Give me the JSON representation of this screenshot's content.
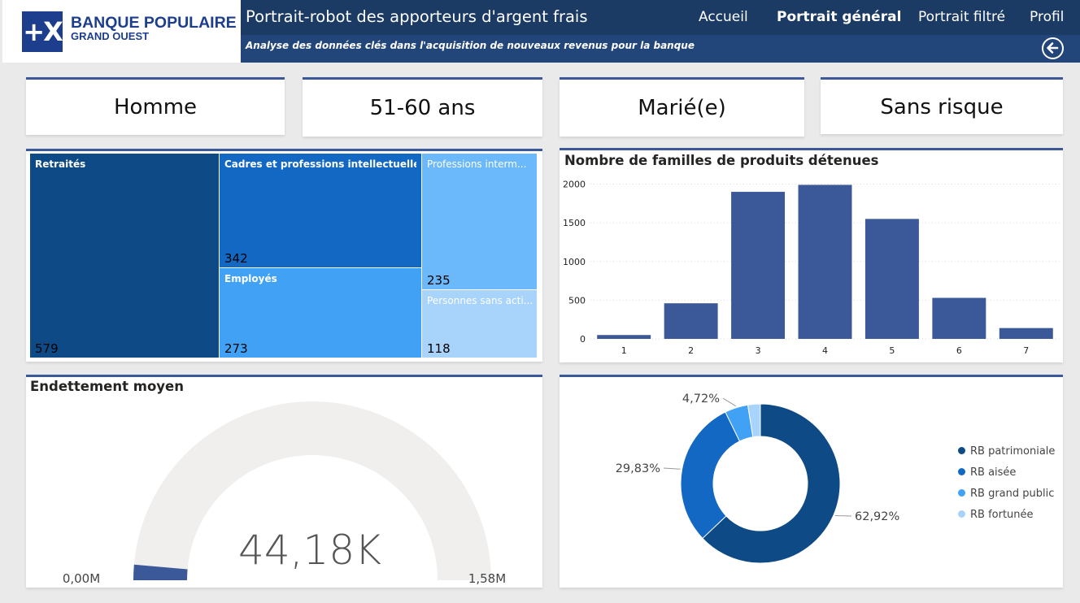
{
  "header": {
    "brand_title": "BANQUE POPULAIRE",
    "brand_subtitle": "GRAND OUEST",
    "brand_mark": "+X",
    "app_title": "Portrait-robot des apporteurs d'argent frais",
    "subtitle": "Analyse des données clés dans l'acquisition de nouveaux revenus pour la banque",
    "nav": [
      "Accueil",
      "Portrait général",
      "Portrait filtré",
      "Profil"
    ],
    "active_nav": "Portrait général",
    "back_icon": "arrow-left-circle-icon"
  },
  "kpis": [
    "Homme",
    "51-60 ans",
    "Marié(e)",
    "Sans risque"
  ],
  "treemap": {
    "items": [
      {
        "label": "Retraités",
        "value": "579",
        "color": "#0e4a85"
      },
      {
        "label": "Cadres et professions intellectuelles...",
        "value": "342",
        "color": "#1368c4"
      },
      {
        "label": "Employés",
        "value": "273",
        "color": "#41a1f5"
      },
      {
        "label": "Professions interm...",
        "value": "235",
        "color": "#6bb8fa"
      },
      {
        "label": "Personnes sans acti...",
        "value": "118",
        "color": "#a8d3fb"
      }
    ]
  },
  "chart_data": [
    {
      "type": "bar",
      "title": "Nombre de familles de produits détenues",
      "categories": [
        "1",
        "2",
        "3",
        "4",
        "5",
        "6",
        "7"
      ],
      "values": [
        50,
        460,
        1900,
        1990,
        1550,
        530,
        140
      ],
      "ylim": [
        0,
        2100
      ],
      "yticks": [
        "0",
        "500",
        "1000",
        "1500",
        "2000"
      ],
      "grid": true,
      "color": "#3b5998"
    },
    {
      "type": "gauge",
      "title": "Endettement moyen",
      "value_label": "44,18K",
      "min_label": "0,00M",
      "max_label": "1,58M",
      "value": 44180,
      "min": 0,
      "max": 1580000,
      "color": "#3b5998"
    },
    {
      "type": "pie",
      "slices": [
        {
          "name": "RB patrimoniale",
          "value": 62.92,
          "label": "62,92%",
          "color": "#0e4a85"
        },
        {
          "name": "RB aisée",
          "value": 29.83,
          "label": "29,83%",
          "color": "#1368c4"
        },
        {
          "name": "RB grand public",
          "value": 4.72,
          "label": "4,72%",
          "color": "#41a1f5"
        },
        {
          "name": "RB fortunée",
          "value": 2.53,
          "label": "",
          "color": "#a8d3fb"
        }
      ],
      "legend_position": "right"
    }
  ]
}
